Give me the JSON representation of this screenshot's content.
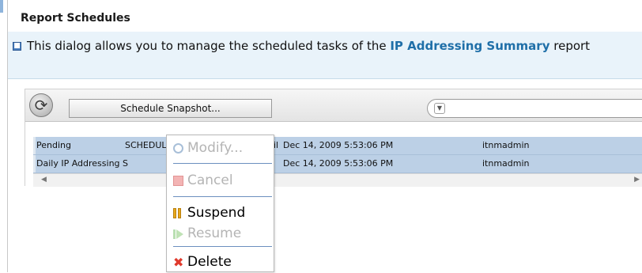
{
  "dialog": {
    "title": "Report Schedules",
    "info_prefix": "This dialog allows you to manage the scheduled tasks of the ",
    "info_link": "IP Addressing Summary",
    "info_suffix": " report"
  },
  "toolbar": {
    "refresh_icon": "refresh-icon",
    "snapshot_label": "Schedule Snapshot...",
    "filter_value": ""
  },
  "table": {
    "rows": [
      {
        "status": "Pending",
        "type": "SCHEDULE",
        "col3": "Dec 14, 2009 5:53:06 PM",
        "owner": "itnmadmin",
        "hidden_fragment": "il"
      },
      {
        "status": "Daily IP Addressing S",
        "type": "",
        "col3": "Dec 14, 2009 5:53:06 PM",
        "owner": "itnmadmin",
        "hidden_fragment": ""
      }
    ]
  },
  "context_menu": {
    "items": [
      {
        "label": "Modify...",
        "enabled": false,
        "icon": "clock-icon"
      },
      {
        "label": "Cancel",
        "enabled": false,
        "icon": "stop-icon"
      },
      {
        "label": "Suspend",
        "enabled": true,
        "icon": "pause-icon"
      },
      {
        "label": "Resume",
        "enabled": false,
        "icon": "play-icon"
      },
      {
        "label": "Delete",
        "enabled": true,
        "icon": "delete-x-icon"
      }
    ]
  },
  "colors": {
    "row_selected": "#bcd0e6",
    "info_bg": "#e9f3fa",
    "link": "#1f6fa8",
    "menu_separator": "#6c8fbf"
  }
}
